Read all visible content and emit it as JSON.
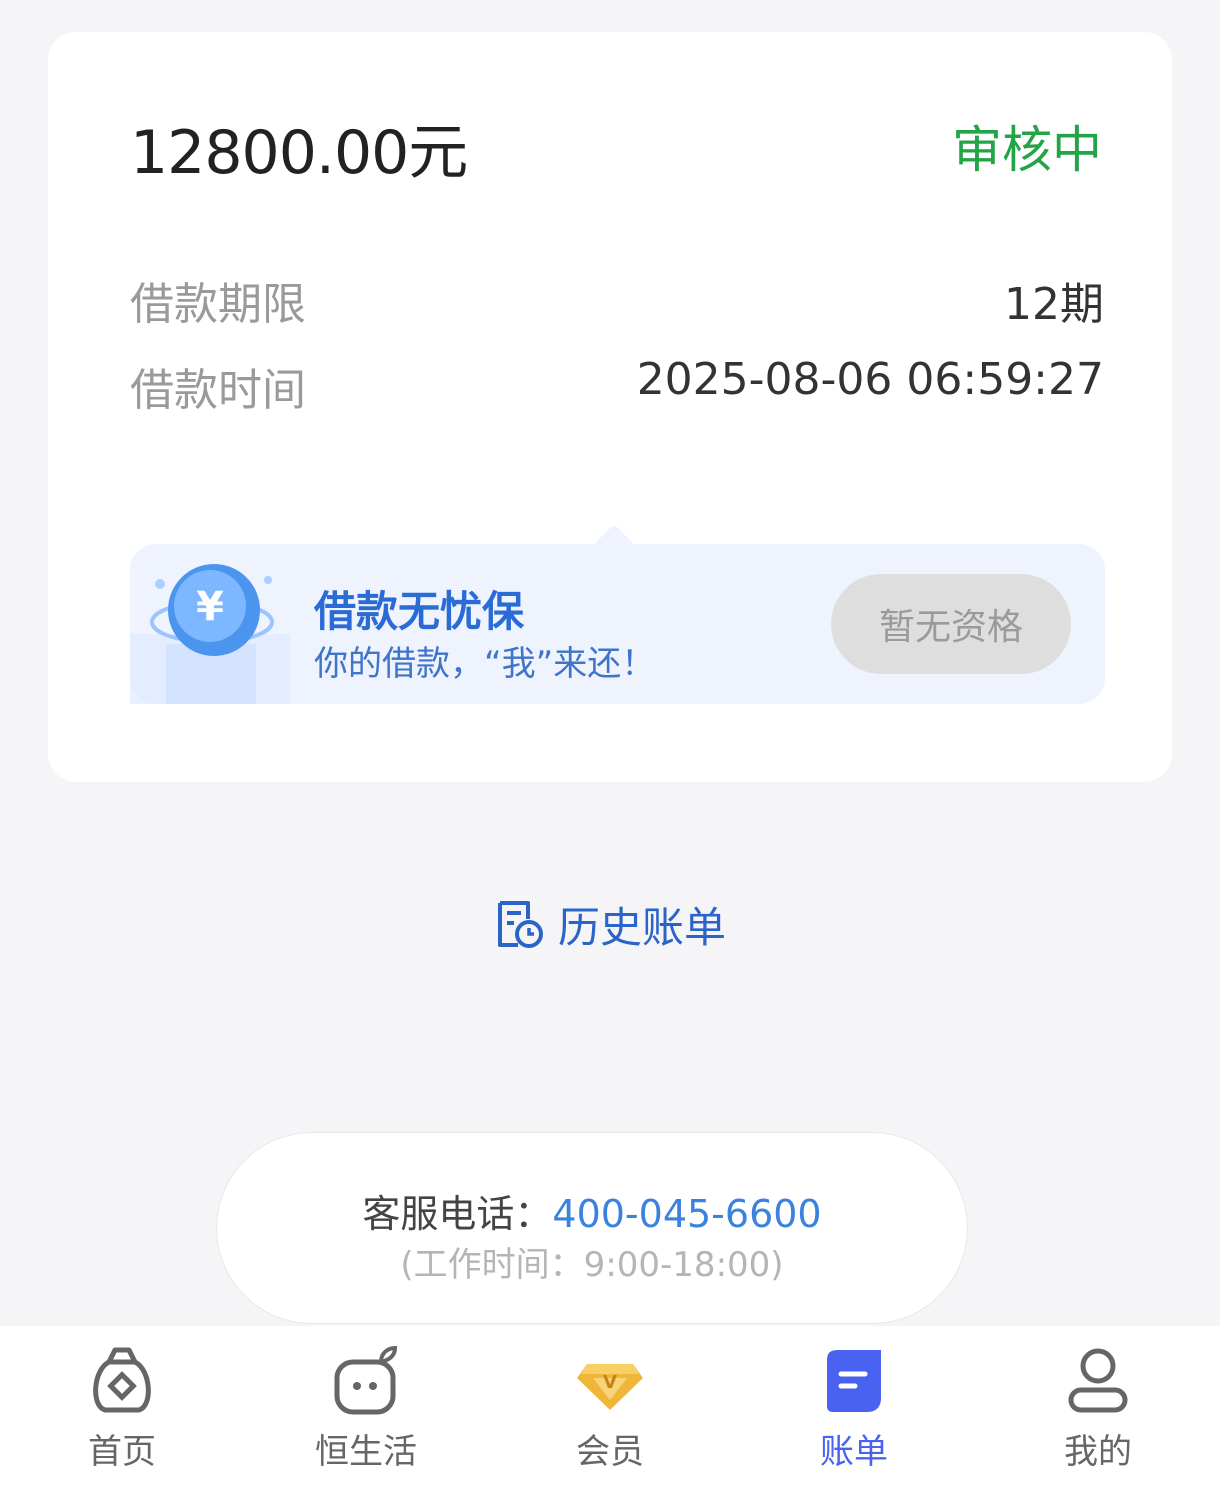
{
  "loan": {
    "amount": "12800.00元",
    "status": "审核中",
    "status_color": "#22a447",
    "term_label": "借款期限",
    "term_value": "12期",
    "time_label": "借款时间",
    "time_value": "2025-08-06 06:59:27"
  },
  "promo": {
    "title": "借款无忧保",
    "subtitle": "你的借款，“我”来还！",
    "button_label": "暂无资格",
    "icon": "yuan-coin-icon"
  },
  "history": {
    "label": "历史账单",
    "icon": "history-bill-icon"
  },
  "service": {
    "phone_label": "客服电话：",
    "phone_number": "400-045-6600",
    "hours": "(工作时间：9:00-18:00)"
  },
  "tabbar": {
    "active_color": "#4a62f0",
    "items": [
      {
        "label": "首页",
        "icon": "money-bag-icon"
      },
      {
        "label": "恒生活",
        "icon": "apple-face-icon"
      },
      {
        "label": "会员",
        "icon": "diamond-v-icon"
      },
      {
        "label": "账单",
        "icon": "bill-icon"
      },
      {
        "label": "我的",
        "icon": "user-icon"
      }
    ]
  }
}
